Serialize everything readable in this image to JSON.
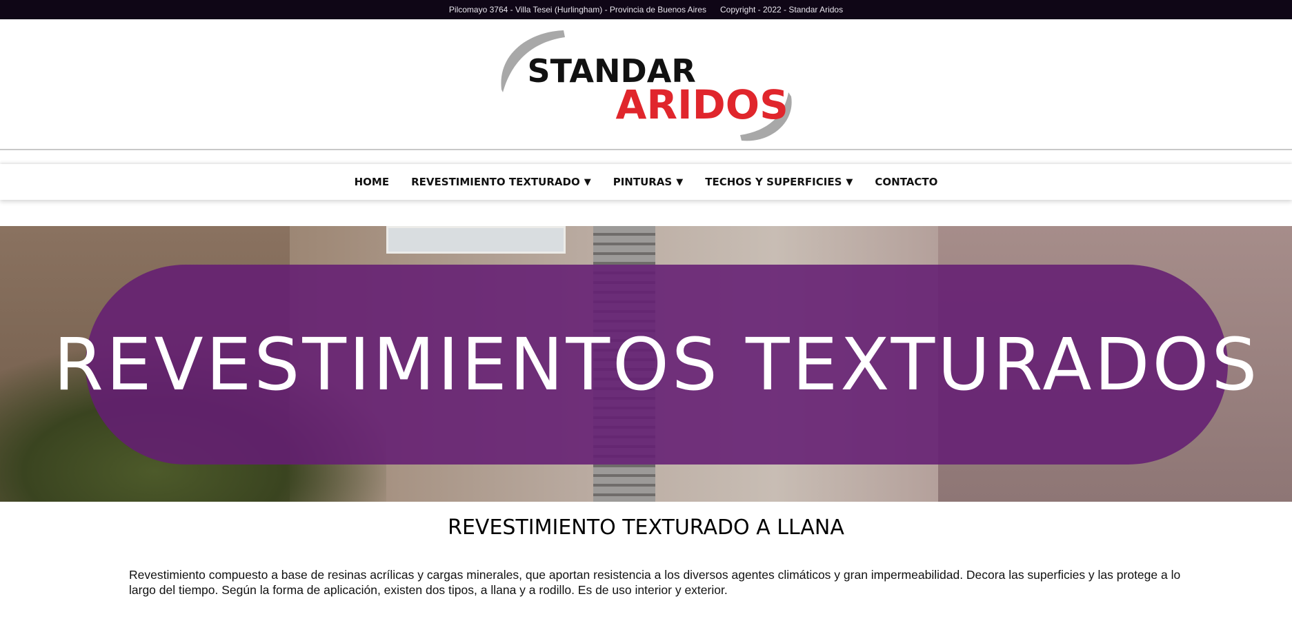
{
  "topbar": {
    "address": "Pilcomayo 3764 - Villa Tesei (Hurlingham) - Provincia de Buenos Aires",
    "copyright": "Copyright - 2022 - Standar Aridos"
  },
  "logo": {
    "line1": "STANDAR",
    "line2": "ARIDOS",
    "colors": {
      "line1": "#111111",
      "line2": "#e0262c",
      "arc": "#a8a8a8"
    }
  },
  "nav": {
    "items": [
      {
        "label": "HOME",
        "dropdown": false
      },
      {
        "label": "REVESTIMIENTO TEXTURADO",
        "dropdown": true
      },
      {
        "label": "PINTURAS",
        "dropdown": true
      },
      {
        "label": "TECHOS Y SUPERFICIES",
        "dropdown": true
      },
      {
        "label": "CONTACTO",
        "dropdown": false
      }
    ],
    "caret": "▼"
  },
  "hero": {
    "title": "REVESTIMIENTOS TEXTURADOS",
    "pill_color": "#641e73"
  },
  "content": {
    "heading": "REVESTIMIENTO TEXTURADO A LLANA",
    "paragraph": "Revestimiento compuesto a base de resinas acrílicas y cargas minerales, que aportan resistencia a los diversos agentes climáticos y gran impermeabilidad. Decora las superficies y las protege a lo largo del tiempo. Según la forma de aplicación, existen dos tipos, a llana y a rodillo. Es de uso interior y exterior."
  }
}
